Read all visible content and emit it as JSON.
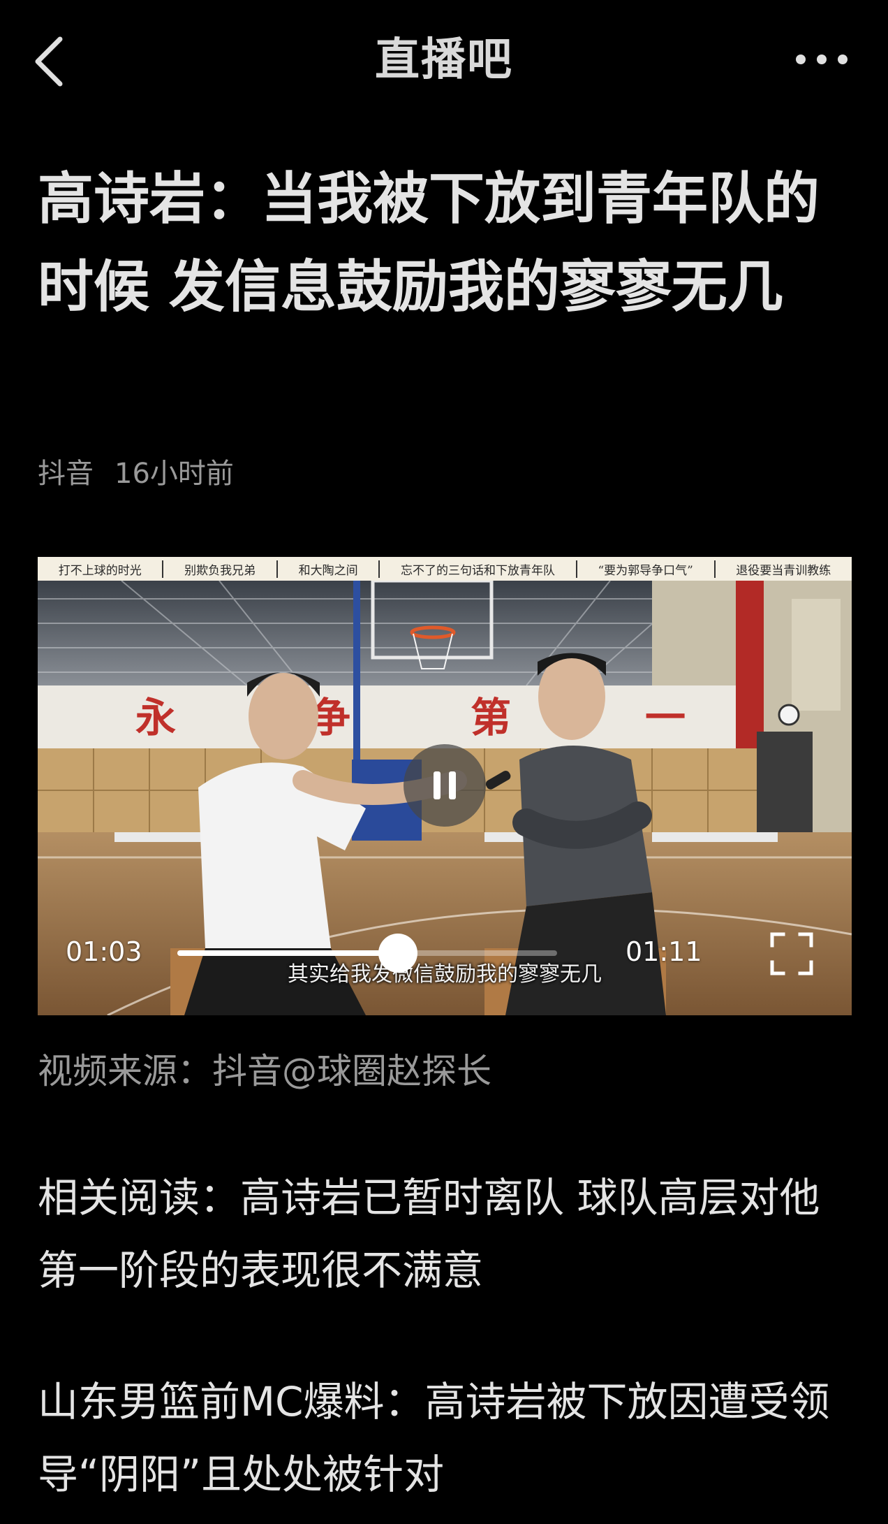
{
  "header": {
    "app_title": "直播吧",
    "back_icon": "chevron-left-icon",
    "more_icon": "more-horizontal-icon"
  },
  "article": {
    "title": "高诗岩：当我被下放到青年队的时候 发信息鼓励我的寥寥无几",
    "source": "抖音",
    "time_ago": "16小时前"
  },
  "video": {
    "chapters": [
      "打不上球的时光",
      "别欺负我兄弟",
      "和大陶之间",
      "忘不了的三句话和下放青年队",
      "“要为郭导争口气”",
      "退役要当青训教练"
    ],
    "court_banner": "永 争 第 一",
    "subtitle": "其实给我发微信鼓励我的寥寥无几",
    "current_time": "01:03",
    "duration": "01:11",
    "progress_fraction": 0.58,
    "state": "playing",
    "pause_icon": "pause-icon",
    "fullscreen_icon": "fullscreen-icon"
  },
  "body": {
    "video_source_line": "视频来源：抖音@球圈赵探长",
    "related_1": "相关阅读：高诗岩已暂时离队 球队高层对他第一阶段的表现很不满意",
    "related_2": "山东男篮前MC爆料：高诗岩被下放因遭受领导“阴阳”且处处被针对"
  },
  "colors": {
    "background": "#000000",
    "text_primary": "#e4e4e4",
    "text_secondary": "#9a9a9a"
  }
}
